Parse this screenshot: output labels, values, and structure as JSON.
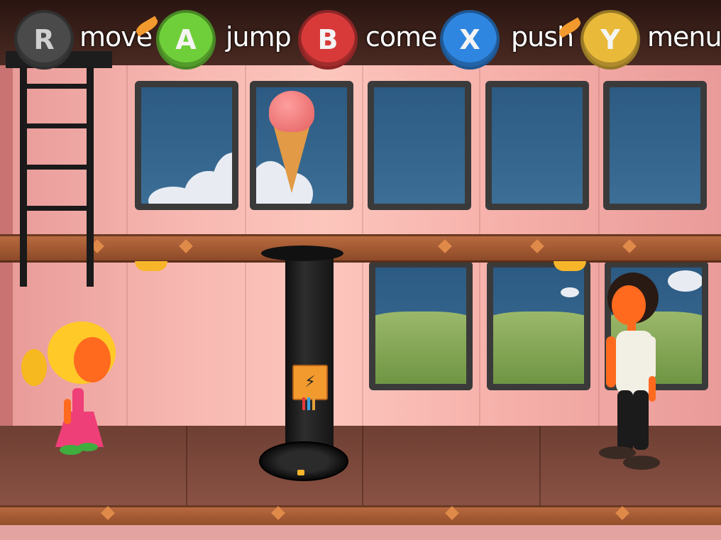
{
  "hud": {
    "controls": [
      {
        "button": "R",
        "label": "move",
        "color": "#4a4a4a"
      },
      {
        "button": "A",
        "label": "jump",
        "color": "#6fcf3a"
      },
      {
        "button": "B",
        "label": "come",
        "color": "#d83a3a"
      },
      {
        "button": "X",
        "label": "push",
        "color": "#2f86e0"
      },
      {
        "button": "Y",
        "label": "menu",
        "color": "#e9b93a"
      }
    ]
  },
  "scene": {
    "switch_icon": "lightning-icon",
    "colors": {
      "wall": "#f7b7b0",
      "beam": "#b86a3e",
      "floor": "#7a4638",
      "girl_dress": "#ef3f78",
      "girl_hair": "#ffc928",
      "boy_shirt": "#f2efe4",
      "skin": "#ff6a1f",
      "icecream_scoop": "#f07a78",
      "icecream_cone": "#e29a46",
      "switch_box": "#f29a2e"
    }
  }
}
